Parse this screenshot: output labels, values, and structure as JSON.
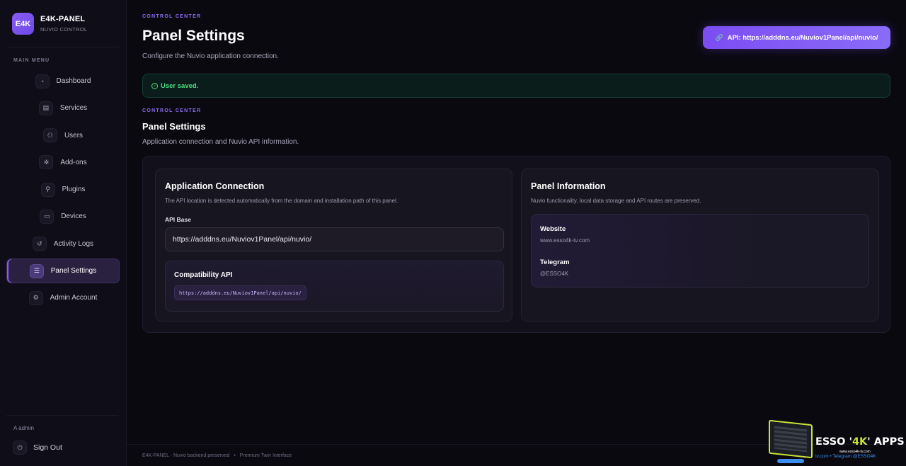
{
  "brand": {
    "logo_text": "E4K",
    "name": "E4K-PANEL",
    "subtitle": "NUVIO CONTROL"
  },
  "sidebar": {
    "menu_title": "MAIN MENU",
    "items": [
      {
        "label": "Dashboard",
        "icon": "gauge-icon",
        "glyph": "◔"
      },
      {
        "label": "Services",
        "icon": "list-icon",
        "glyph": "▤"
      },
      {
        "label": "Users",
        "icon": "users-icon",
        "glyph": "⚇"
      },
      {
        "label": "Add-ons",
        "icon": "puzzle-icon",
        "glyph": "✲"
      },
      {
        "label": "Plugins",
        "icon": "plug-icon",
        "glyph": "⚲"
      },
      {
        "label": "Devices",
        "icon": "monitor-icon",
        "glyph": "▭"
      },
      {
        "label": "Activity Logs",
        "icon": "history-icon",
        "glyph": "↺"
      },
      {
        "label": "Panel Settings",
        "icon": "sliders-icon",
        "glyph": "☰",
        "active": true
      },
      {
        "label": "Admin Account",
        "icon": "user-gear-icon",
        "glyph": "⚙"
      }
    ],
    "admin_label": "A admin",
    "signout_label": "Sign Out",
    "signout_glyph": "⏻"
  },
  "header": {
    "eyebrow": "CONTROL CENTER",
    "title": "Panel Settings",
    "subtitle": "Configure the Nuvio application connection.",
    "api_button_label": "API: https://adddns.eu/Nuviov1Panel/api/nuvio/",
    "api_button_glyph": "🔗"
  },
  "alert": {
    "message": "User saved.",
    "glyph": "✓"
  },
  "section": {
    "eyebrow": "CONTROL CENTER",
    "title": "Panel Settings",
    "subtitle": "Application connection and Nuvio API information."
  },
  "app_connection": {
    "title": "Application Connection",
    "subtitle": "The API location is detected automatically from the domain and installation path of this panel.",
    "field_label": "API Base",
    "api_base_value": "https://adddns.eu/Nuviov1Panel/api/nuvio/",
    "compat_title": "Compatibility API",
    "compat_value": "https://adddns.eu/Nuviov1Panel/api/nuvio/"
  },
  "panel_info": {
    "title": "Panel Information",
    "subtitle": "Nuvio functionality, local data storage and API routes are preserved.",
    "website_label": "Website",
    "website_value": "www.esso4k-tv.com",
    "telegram_label": "Telegram",
    "telegram_value": "@ESSO4K"
  },
  "footer": {
    "left": "E4K-PANEL · Nuvio backend preserved",
    "right": "Premium Twin Interface",
    "separator": "•"
  },
  "watermark": {
    "title_a": "ESSO '",
    "title_hl": "4K",
    "title_b": "' APPS",
    "site": "www.esso4k-tv.com",
    "foot": "tv.com  •  Telegram @ESSO4K"
  },
  "colors": {
    "accent": "#8b5cf6",
    "success": "#4ade80",
    "background": "#0a0910"
  }
}
